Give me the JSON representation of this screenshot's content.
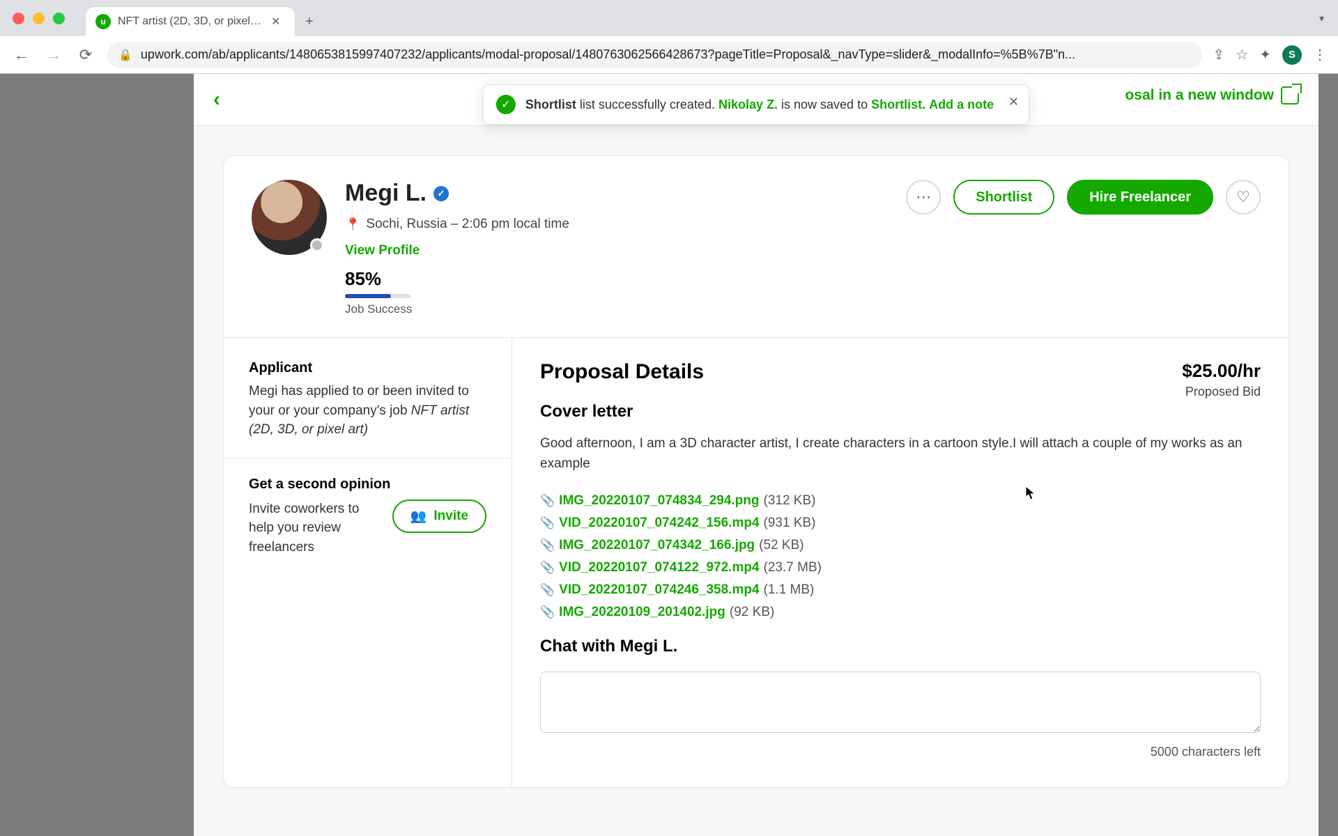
{
  "browser": {
    "tab_title": "NFT artist (2D, 3D, or pixel art)",
    "url": "upwork.com/ab/applicants/1480653815997407232/applicants/modal-proposal/1480763062566428673?pageTitle=Proposal&_navType=slider&_modalInfo=%5B%7B\"n...",
    "avatar_letter": "S"
  },
  "toast": {
    "strong1": "Shortlist",
    "text1": " list successfully created. ",
    "name": "Nikolay Z.",
    "text2": " is now saved to ",
    "link1": "Shortlist.",
    "link2": "Add a note"
  },
  "modal_header": {
    "open_new_label": "osal in a new window"
  },
  "profile": {
    "name": "Megi L.",
    "location": "Sochi, Russia – 2:06 pm local time",
    "view_profile": "View Profile",
    "success_pct": "85%",
    "success_label": "Job Success",
    "success_fill_pct": 70
  },
  "actions": {
    "shortlist": "Shortlist",
    "hire": "Hire Freelancer"
  },
  "applicant": {
    "title": "Applicant",
    "text": "Megi has applied to or been invited to your or your company's job ",
    "job": "NFT artist (2D, 3D, or pixel art)"
  },
  "second_opinion": {
    "title": "Get a second opinion",
    "text": "Invite coworkers to help you review freelancers",
    "button": "Invite"
  },
  "proposal": {
    "heading": "Proposal Details",
    "bid_amount": "$25.00/hr",
    "bid_label": "Proposed Bid",
    "cover_heading": "Cover letter",
    "cover_text": "Good afternoon, I am a 3D character artist, I create characters in a cartoon style.I will attach a couple of my works as an example",
    "attachments": [
      {
        "name": "IMG_20220107_074834_294.png",
        "size": "(312 KB)"
      },
      {
        "name": "VID_20220107_074242_156.mp4",
        "size": "(931 KB)"
      },
      {
        "name": "IMG_20220107_074342_166.jpg",
        "size": "(52 KB)"
      },
      {
        "name": "VID_20220107_074122_972.mp4",
        "size": "(23.7 MB)"
      },
      {
        "name": "VID_20220107_074246_358.mp4",
        "size": "(1.1 MB)"
      },
      {
        "name": "IMG_20220109_201402.jpg",
        "size": "(92 KB)"
      }
    ],
    "chat_heading": "Chat with Megi L.",
    "chars_left": "5000 characters left"
  }
}
